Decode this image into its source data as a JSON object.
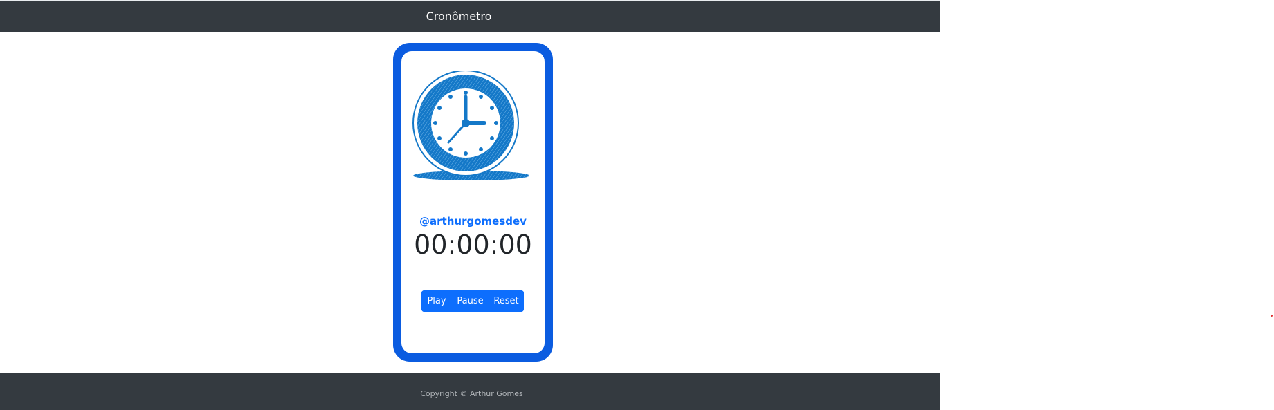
{
  "navbar": {
    "title": "Cronômetro"
  },
  "card": {
    "clock_image": "clock-icon",
    "handle": "@arthurgomesdev",
    "timer": "00:00:00",
    "buttons": {
      "play": "Play",
      "pause": "Pause",
      "reset": "Reset"
    }
  },
  "footer": {
    "copyright": "Copyright © Arthur Gomes"
  },
  "colors": {
    "primary": "#0d6efd",
    "phone_frame": "#0b5ce0",
    "bar": "#343a40"
  }
}
